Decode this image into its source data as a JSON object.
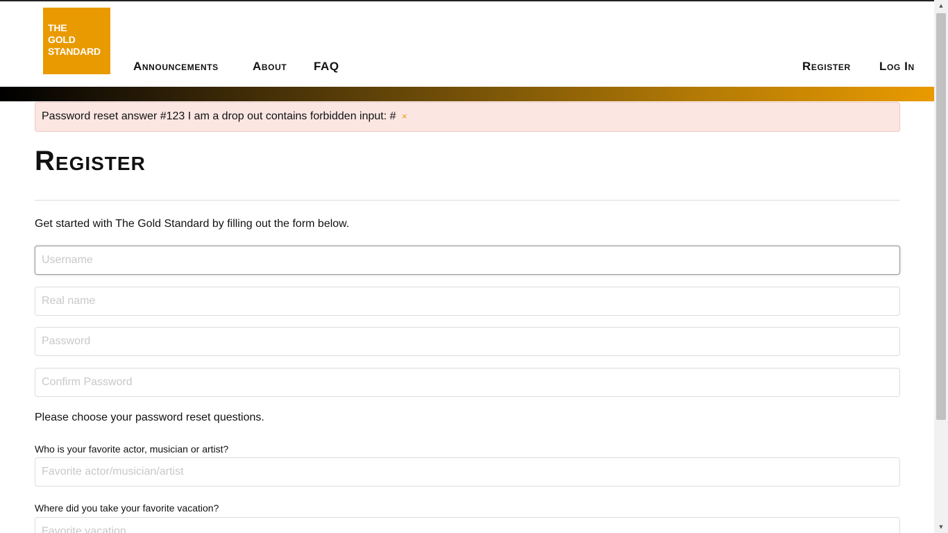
{
  "header": {
    "logo_lines": [
      "THE",
      "GOLD",
      "STANDARD"
    ],
    "nav": {
      "announcements": "Announcements",
      "about": "About",
      "faq": "FAQ"
    },
    "right_nav": {
      "register": "Register",
      "login": "Log In"
    }
  },
  "alert": {
    "message": "Password reset answer #123 I am a drop out contains forbidden input: #",
    "close_symbol": "×"
  },
  "page": {
    "title": "Register",
    "intro": "Get started with The Gold Standard by filling out the form below."
  },
  "form": {
    "username_placeholder": "Username",
    "realname_placeholder": "Real name",
    "password_placeholder": "Password",
    "confirm_placeholder": "Confirm Password",
    "reset_intro": "Please choose your password reset questions.",
    "q1_label": "Who is your favorite actor, musician or artist?",
    "q1_placeholder": "Favorite actor/musician/artist",
    "q2_label": "Where did you take your favorite vacation?",
    "q2_placeholder": "Favorite vacation"
  },
  "scrollbar": {
    "up_symbol": "▲",
    "down_symbol": "▼"
  },
  "colors": {
    "accent": "#e99a00",
    "alert_bg": "#fbe6e2"
  }
}
